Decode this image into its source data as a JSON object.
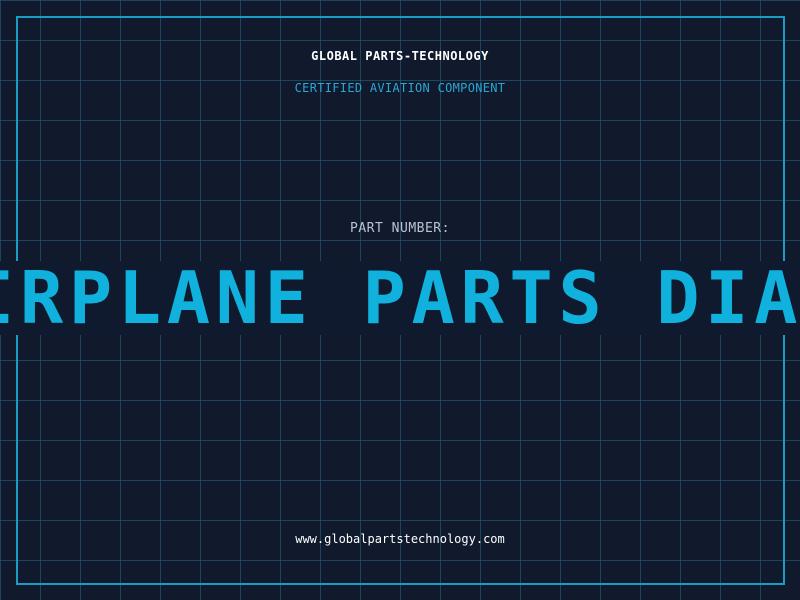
{
  "header": {
    "company": "GLOBAL PARTS-TECHNOLOGY",
    "subtitle": "CERTIFIED AVIATION COMPONENT"
  },
  "part": {
    "label": "PART NUMBER:",
    "number": "AIRPLANE PARTS DIAGRAM WITH NAMES"
  },
  "footer": {
    "url": "www.globalpartstechnology.com"
  },
  "colors": {
    "background": "#101a2c",
    "grid": "#226987",
    "frame": "#1a9cc4",
    "accent": "#10b2dd"
  }
}
